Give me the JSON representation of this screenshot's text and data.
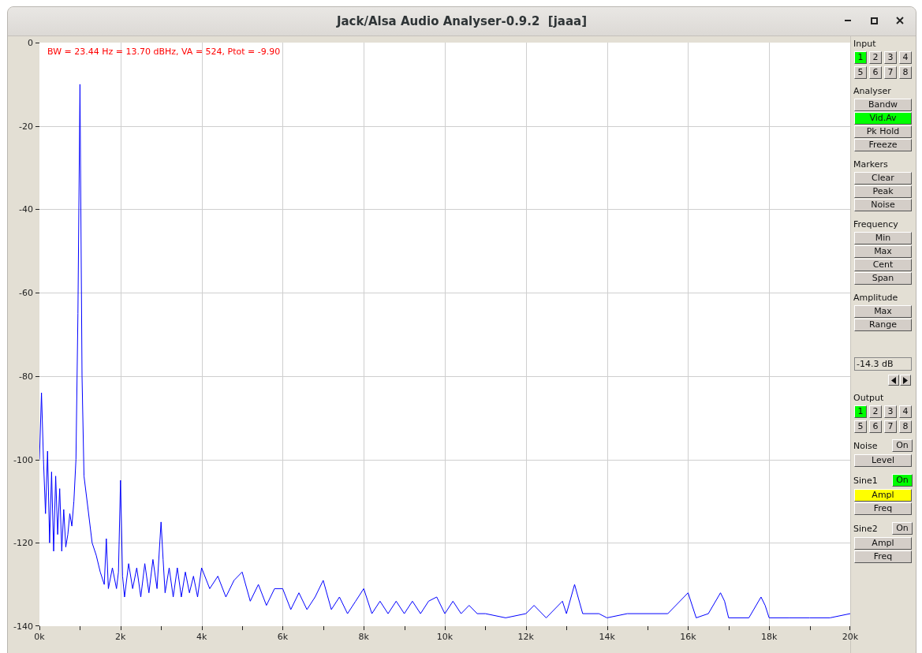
{
  "window": {
    "title": "Jack/Alsa Audio Analyser-0.9.2  [jaaa]"
  },
  "plot": {
    "readout": "BW = 23.44 Hz = 13.70 dBHz, VA = 524, Ptot = -9.90",
    "chart_data": {
      "type": "line",
      "grid": true,
      "xlim": [
        0,
        20
      ],
      "ylim": [
        -140,
        0
      ],
      "yticks": [
        0,
        -20,
        -40,
        -60,
        -80,
        -100,
        -120,
        -140
      ],
      "xticks": [
        {
          "value": 0,
          "label": "0k"
        },
        {
          "value": 2,
          "label": "2k"
        },
        {
          "value": 4,
          "label": "4k"
        },
        {
          "value": 6,
          "label": "6k"
        },
        {
          "value": 8,
          "label": "8k"
        },
        {
          "value": 10,
          "label": "10k"
        },
        {
          "value": 12,
          "label": "12k"
        },
        {
          "value": 14,
          "label": "14k"
        },
        {
          "value": 16,
          "label": "16k"
        },
        {
          "value": 18,
          "label": "18k"
        },
        {
          "value": 20,
          "label": "20k"
        }
      ],
      "x": [
        0,
        0.05,
        0.1,
        0.15,
        0.2,
        0.25,
        0.3,
        0.35,
        0.4,
        0.45,
        0.5,
        0.55,
        0.6,
        0.65,
        0.7,
        0.75,
        0.8,
        0.85,
        0.9,
        0.95,
        1.0,
        1.05,
        1.1,
        1.2,
        1.3,
        1.4,
        1.5,
        1.6,
        1.65,
        1.7,
        1.8,
        1.9,
        1.95,
        2.0,
        2.05,
        2.1,
        2.2,
        2.3,
        2.4,
        2.5,
        2.6,
        2.7,
        2.8,
        2.9,
        3.0,
        3.05,
        3.1,
        3.2,
        3.3,
        3.4,
        3.5,
        3.6,
        3.7,
        3.8,
        3.9,
        4.0,
        4.2,
        4.4,
        4.6,
        4.8,
        5.0,
        5.2,
        5.4,
        5.6,
        5.8,
        6.0,
        6.2,
        6.4,
        6.6,
        6.8,
        7.0,
        7.2,
        7.4,
        7.6,
        7.8,
        8.0,
        8.2,
        8.4,
        8.6,
        8.8,
        9.0,
        9.2,
        9.4,
        9.6,
        9.8,
        10.0,
        10.2,
        10.4,
        10.6,
        10.8,
        11.0,
        11.5,
        12.0,
        12.2,
        12.5,
        12.9,
        13.0,
        13.2,
        13.4,
        13.8,
        14.0,
        14.5,
        15.0,
        15.5,
        16.0,
        16.2,
        16.5,
        16.8,
        16.9,
        17.0,
        17.5,
        17.8,
        17.9,
        18.0,
        18.5,
        19.0,
        19.5,
        20.0
      ],
      "series": [
        {
          "color": "#0000ff",
          "values": [
            -100,
            -84,
            -100,
            -113,
            -98,
            -120,
            -103,
            -122,
            -104,
            -118,
            -107,
            -122,
            -112,
            -121,
            -118,
            -113,
            -116,
            -110,
            -100,
            -65,
            -10,
            -80,
            -104,
            -112,
            -120,
            -123,
            -127,
            -130,
            -119,
            -131,
            -126,
            -131,
            -127,
            -105,
            -128,
            -133,
            -125,
            -131,
            -126,
            -133,
            -125,
            -132,
            -124,
            -131,
            -115,
            -124,
            -132,
            -126,
            -133,
            -126,
            -133,
            -127,
            -132,
            -128,
            -133,
            -126,
            -131,
            -128,
            -133,
            -129,
            -127,
            -134,
            -130,
            -135,
            -131,
            -131,
            -136,
            -132,
            -136,
            -133,
            -129,
            -136,
            -133,
            -137,
            -134,
            -131,
            -137,
            -134,
            -137,
            -134,
            -137,
            -134,
            -137,
            -134,
            -133,
            -137,
            -134,
            -137,
            -135,
            -137,
            -137,
            -138,
            -137,
            -135,
            -138,
            -134,
            -137,
            -130,
            -137,
            -137,
            -138,
            -137,
            -137,
            -137,
            -132,
            -138,
            -137,
            -132,
            -134,
            -138,
            -138,
            -133,
            -135,
            -138,
            -138,
            -138,
            -138,
            -137
          ]
        }
      ]
    }
  },
  "panel": [
    {
      "kind": "label",
      "text": "Input"
    },
    {
      "kind": "grid",
      "buttons": [
        {
          "label": "1",
          "selected": true
        },
        {
          "label": "2",
          "selected": false
        },
        {
          "label": "3",
          "selected": false
        },
        {
          "label": "4",
          "selected": false
        },
        {
          "label": "5",
          "selected": false
        },
        {
          "label": "6",
          "selected": false
        },
        {
          "label": "7",
          "selected": false
        },
        {
          "label": "8",
          "selected": false
        }
      ]
    },
    {
      "kind": "label",
      "text": "Analyser"
    },
    {
      "kind": "button",
      "label": "Bandw",
      "on": false,
      "selected": false
    },
    {
      "kind": "button",
      "label": "Vid.Av",
      "on": true,
      "selected": false
    },
    {
      "kind": "button",
      "label": "Pk Hold",
      "on": false,
      "selected": false
    },
    {
      "kind": "button",
      "label": "Freeze",
      "on": false,
      "selected": false
    },
    {
      "kind": "label",
      "text": "Markers"
    },
    {
      "kind": "button",
      "label": "Clear",
      "on": false,
      "selected": false
    },
    {
      "kind": "button",
      "label": "Peak",
      "on": false,
      "selected": false
    },
    {
      "kind": "button",
      "label": "Noise",
      "on": false,
      "selected": false
    },
    {
      "kind": "label",
      "text": "Frequency"
    },
    {
      "kind": "button",
      "label": "Min",
      "on": false,
      "selected": false
    },
    {
      "kind": "button",
      "label": "Max",
      "on": false,
      "selected": false
    },
    {
      "kind": "button",
      "label": "Cent",
      "on": false,
      "selected": false
    },
    {
      "kind": "button",
      "label": "Span",
      "on": false,
      "selected": false
    },
    {
      "kind": "label",
      "text": "Amplitude"
    },
    {
      "kind": "button",
      "label": "Max",
      "on": false,
      "selected": false
    },
    {
      "kind": "button",
      "label": "Range",
      "on": false,
      "selected": false
    },
    {
      "kind": "field",
      "value": "-14.3 dB"
    },
    {
      "kind": "arrows"
    },
    {
      "kind": "label",
      "text": "Output"
    },
    {
      "kind": "grid",
      "buttons": [
        {
          "label": "1",
          "selected": true
        },
        {
          "label": "2",
          "selected": false
        },
        {
          "label": "3",
          "selected": false
        },
        {
          "label": "4",
          "selected": false
        },
        {
          "label": "5",
          "selected": false
        },
        {
          "label": "6",
          "selected": false
        },
        {
          "label": "7",
          "selected": false
        },
        {
          "label": "8",
          "selected": false
        }
      ]
    },
    {
      "kind": "toggle",
      "text": "Noise",
      "button": {
        "label": "On",
        "on": false
      }
    },
    {
      "kind": "button",
      "label": "Level",
      "on": false,
      "selected": false
    },
    {
      "kind": "toggle",
      "text": "Sine1",
      "button": {
        "label": "On",
        "on": true
      }
    },
    {
      "kind": "button",
      "label": "Ampl",
      "on": false,
      "selected": true
    },
    {
      "kind": "button",
      "label": "Freq",
      "on": false,
      "selected": false
    },
    {
      "kind": "toggle",
      "text": "Sine2",
      "button": {
        "label": "On",
        "on": false
      }
    },
    {
      "kind": "button",
      "label": "Ampl",
      "on": false,
      "selected": false
    },
    {
      "kind": "button",
      "label": "Freq",
      "on": false,
      "selected": false
    }
  ]
}
